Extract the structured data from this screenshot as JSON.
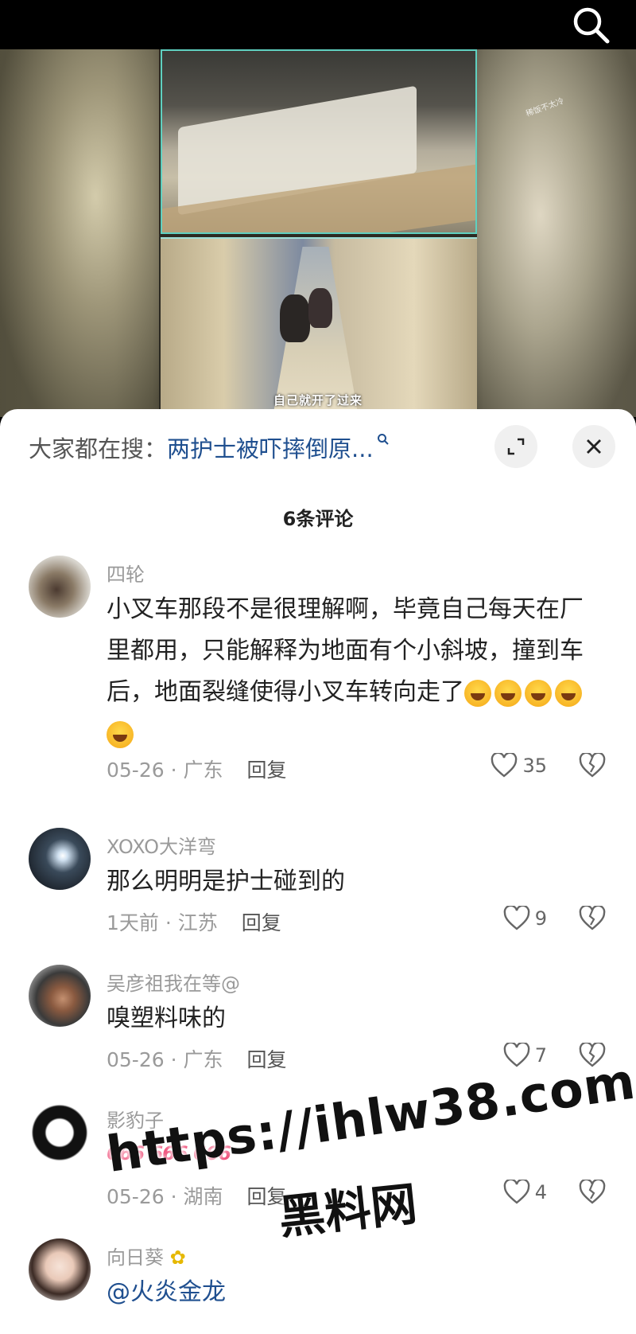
{
  "video": {
    "caption": "自己就开了过来",
    "corner_mark": "稀饭不太冷"
  },
  "sheet": {
    "hot_label": "大家都在搜：",
    "hot_query": "两护士被吓摔倒原...",
    "comment_count": "6条评论"
  },
  "comments": [
    {
      "user": "四轮",
      "text": "小叉车那段不是很理解啊，毕竟自己每天在厂里都用，只能解释为地面有个小斜坡，撞到车后，地面裂缝使得小叉车转向走了",
      "emoji": "🤣🤣🤣🤣🤣",
      "meta": "05-26 · 广东",
      "reply": "回复",
      "likes": "35"
    },
    {
      "user": "XOXO大洋弯",
      "text": "那么明明是护士碰到的",
      "meta": "1天前 · 江苏",
      "reply": "回复",
      "likes": "9"
    },
    {
      "user": "吴彦祖我在等@",
      "text": "嗅塑料味的",
      "meta": "05-26 · 广东",
      "reply": "回复",
      "likes": "7"
    },
    {
      "user": "影豹子",
      "text": "666 666 666",
      "meta": "05-26 · 湖南",
      "reply": "回复",
      "likes": "4"
    },
    {
      "user": "向日葵",
      "text": "@火炎金龙"
    }
  ],
  "watermark": {
    "url": "https://ihlw38.com",
    "name": "黑料网"
  },
  "colors": {
    "link": "#1f4f8f",
    "meta": "#9a9a9a",
    "video_frame": "#5fd0c0"
  }
}
